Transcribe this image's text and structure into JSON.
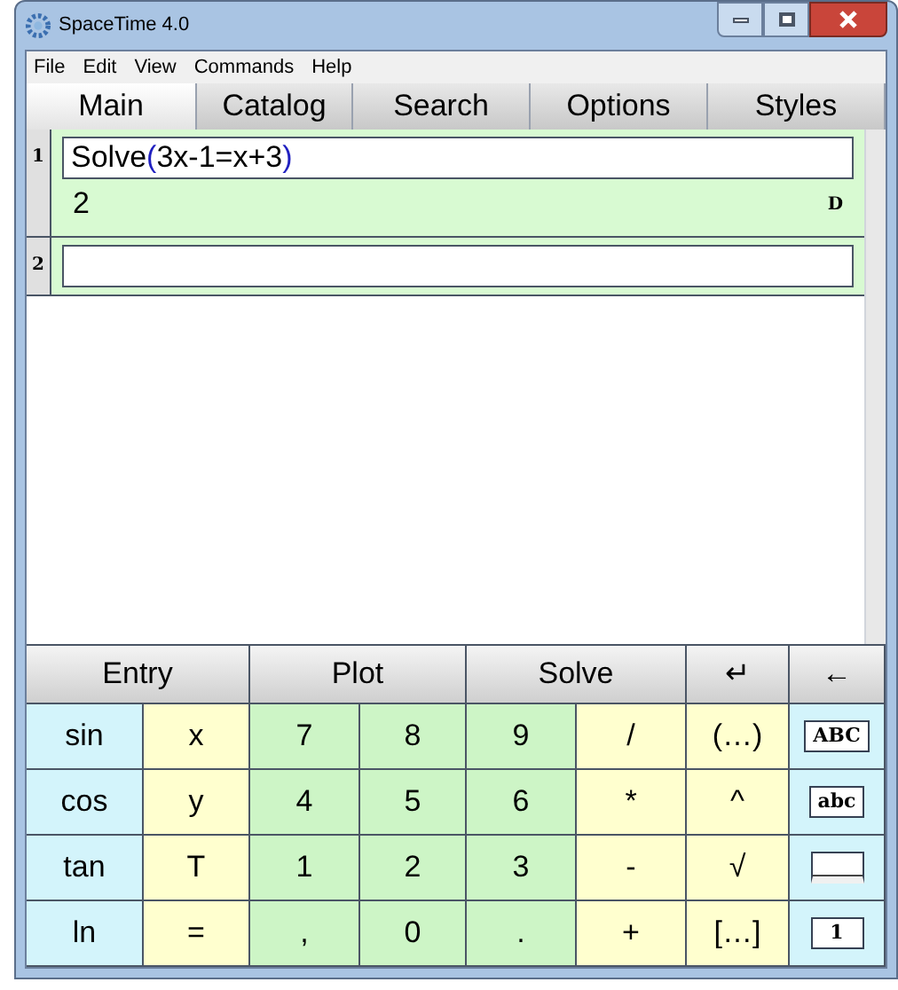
{
  "window": {
    "title": "SpaceTime 4.0"
  },
  "menu": [
    "File",
    "Edit",
    "View",
    "Commands",
    "Help"
  ],
  "tabs": [
    {
      "label": "Main",
      "selected": true
    },
    {
      "label": "Catalog",
      "selected": false
    },
    {
      "label": "Search",
      "selected": false
    },
    {
      "label": "Options",
      "selected": false
    },
    {
      "label": "Styles",
      "selected": false
    }
  ],
  "entries": [
    {
      "number": "1",
      "input": [
        {
          "text": "Solve",
          "color": "#000000"
        },
        {
          "text": "(",
          "color": "#2020c0"
        },
        {
          "text": "3x-1=x+3",
          "color": "#000000"
        },
        {
          "text": ")",
          "color": "#2020c0"
        }
      ],
      "result": "2",
      "flag": "D"
    },
    {
      "number": "2"
    }
  ],
  "keypad_header": [
    {
      "label": "Entry",
      "kind": "wide"
    },
    {
      "label": "Plot",
      "kind": "wide"
    },
    {
      "label": "Solve",
      "kind": "wide"
    },
    {
      "label": "↵",
      "kind": "narrow"
    },
    {
      "label": "←",
      "kind": "narrow"
    }
  ],
  "keys": [
    [
      {
        "label": "sin",
        "color": "#d3f4fb",
        "kind": "text"
      },
      {
        "label": "x",
        "color": "#ffffcf",
        "kind": "text"
      },
      {
        "label": "7",
        "color": "#cdf5c6",
        "kind": "text"
      },
      {
        "label": "8",
        "color": "#cdf5c6",
        "kind": "text"
      },
      {
        "label": "9",
        "color": "#cdf5c6",
        "kind": "text"
      },
      {
        "label": "/",
        "color": "#ffffcf",
        "kind": "text"
      },
      {
        "label": "(…)",
        "color": "#ffffcf",
        "kind": "text"
      },
      {
        "label": "ABC",
        "color": "#d3f4fb",
        "kind": "boxed"
      }
    ],
    [
      {
        "label": "cos",
        "color": "#d3f4fb",
        "kind": "text"
      },
      {
        "label": "y",
        "color": "#ffffcf",
        "kind": "text"
      },
      {
        "label": "4",
        "color": "#cdf5c6",
        "kind": "text"
      },
      {
        "label": "5",
        "color": "#cdf5c6",
        "kind": "text"
      },
      {
        "label": "6",
        "color": "#cdf5c6",
        "kind": "text"
      },
      {
        "label": "*",
        "color": "#ffffcf",
        "kind": "text"
      },
      {
        "label": "^",
        "color": "#ffffcf",
        "kind": "text"
      },
      {
        "label": "abc",
        "color": "#d3f4fb",
        "kind": "boxed"
      }
    ],
    [
      {
        "label": "tan",
        "color": "#d3f4fb",
        "kind": "text"
      },
      {
        "label": "T",
        "color": "#ffffcf",
        "kind": "text"
      },
      {
        "label": "1",
        "color": "#cdf5c6",
        "kind": "text"
      },
      {
        "label": "2",
        "color": "#cdf5c6",
        "kind": "text"
      },
      {
        "label": "3",
        "color": "#cdf5c6",
        "kind": "text"
      },
      {
        "label": "-",
        "color": "#ffffcf",
        "kind": "text"
      },
      {
        "label": "√",
        "color": "#ffffcf",
        "kind": "text"
      },
      {
        "color": "#d3f4fb",
        "kind": "blank-box"
      }
    ],
    [
      {
        "label": "ln",
        "color": "#d3f4fb",
        "kind": "text"
      },
      {
        "label": "=",
        "color": "#ffffcf",
        "kind": "text"
      },
      {
        "label": ",",
        "color": "#cdf5c6",
        "kind": "text"
      },
      {
        "label": "0",
        "color": "#cdf5c6",
        "kind": "text"
      },
      {
        "label": ".",
        "color": "#cdf5c6",
        "kind": "text"
      },
      {
        "label": "+",
        "color": "#ffffcf",
        "kind": "text"
      },
      {
        "label": "[…]",
        "color": "#ffffcf",
        "kind": "text"
      },
      {
        "label": "1",
        "color": "#d3f4fb",
        "kind": "boxed"
      }
    ]
  ]
}
